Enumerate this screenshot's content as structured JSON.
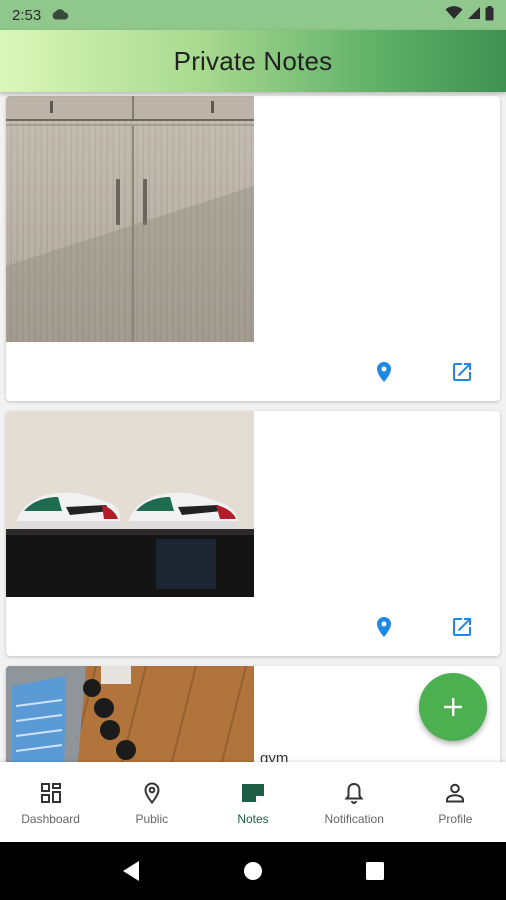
{
  "status_bar": {
    "time": "2:53",
    "cloud_icon": "cloud-icon",
    "wifi_icon": "wifi-icon",
    "signal_icon": "signal-icon",
    "battery_icon": "battery-icon"
  },
  "app_bar": {
    "title": "Private Notes"
  },
  "notes": [
    {
      "photo": "wardrobe",
      "text": "",
      "location_icon": "location-pin-icon",
      "open_icon": "open-in-new-icon"
    },
    {
      "photo": "sneakers",
      "text": "",
      "location_icon": "location-pin-icon",
      "open_icon": "open-in-new-icon"
    },
    {
      "photo": "gym",
      "text": "gym"
    }
  ],
  "fab": {
    "icon": "add-icon"
  },
  "bottom_nav": {
    "items": [
      {
        "label": "Dashboard",
        "icon": "dashboard-icon"
      },
      {
        "label": "Public",
        "icon": "location-pin-icon"
      },
      {
        "label": "Notes",
        "icon": "notes-icon",
        "active": true
      },
      {
        "label": "Notification",
        "icon": "bell-icon"
      },
      {
        "label": "Profile",
        "icon": "person-icon"
      }
    ]
  },
  "colors": {
    "accent_blue": "#1e88e5",
    "fab_green": "#4caf50",
    "active_nav": "#1d5c45"
  }
}
